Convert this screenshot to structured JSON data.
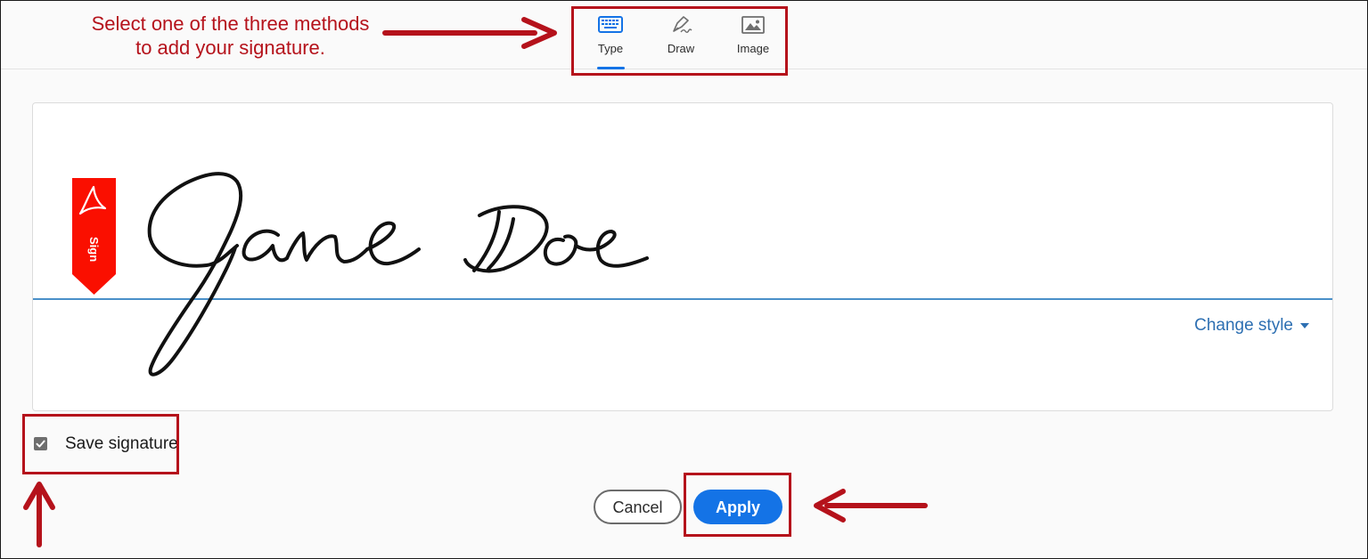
{
  "annotation": {
    "text_line1": "Select one of the three methods",
    "text_line2": "to add your signature."
  },
  "tabs": [
    {
      "label": "Type",
      "icon": "keyboard-icon",
      "selected": true
    },
    {
      "label": "Draw",
      "icon": "pen-icon",
      "selected": false
    },
    {
      "label": "Image",
      "icon": "image-icon",
      "selected": false
    }
  ],
  "signature": {
    "text": "Jane Doe",
    "flag_label": "Sign",
    "change_style_label": "Change style"
  },
  "save": {
    "label": "Save signature",
    "checked": true
  },
  "buttons": {
    "cancel": "Cancel",
    "apply": "Apply"
  },
  "colors": {
    "annotation_red": "#b5121b",
    "accent_blue": "#1473e6",
    "adobe_red": "#fa0f00"
  }
}
